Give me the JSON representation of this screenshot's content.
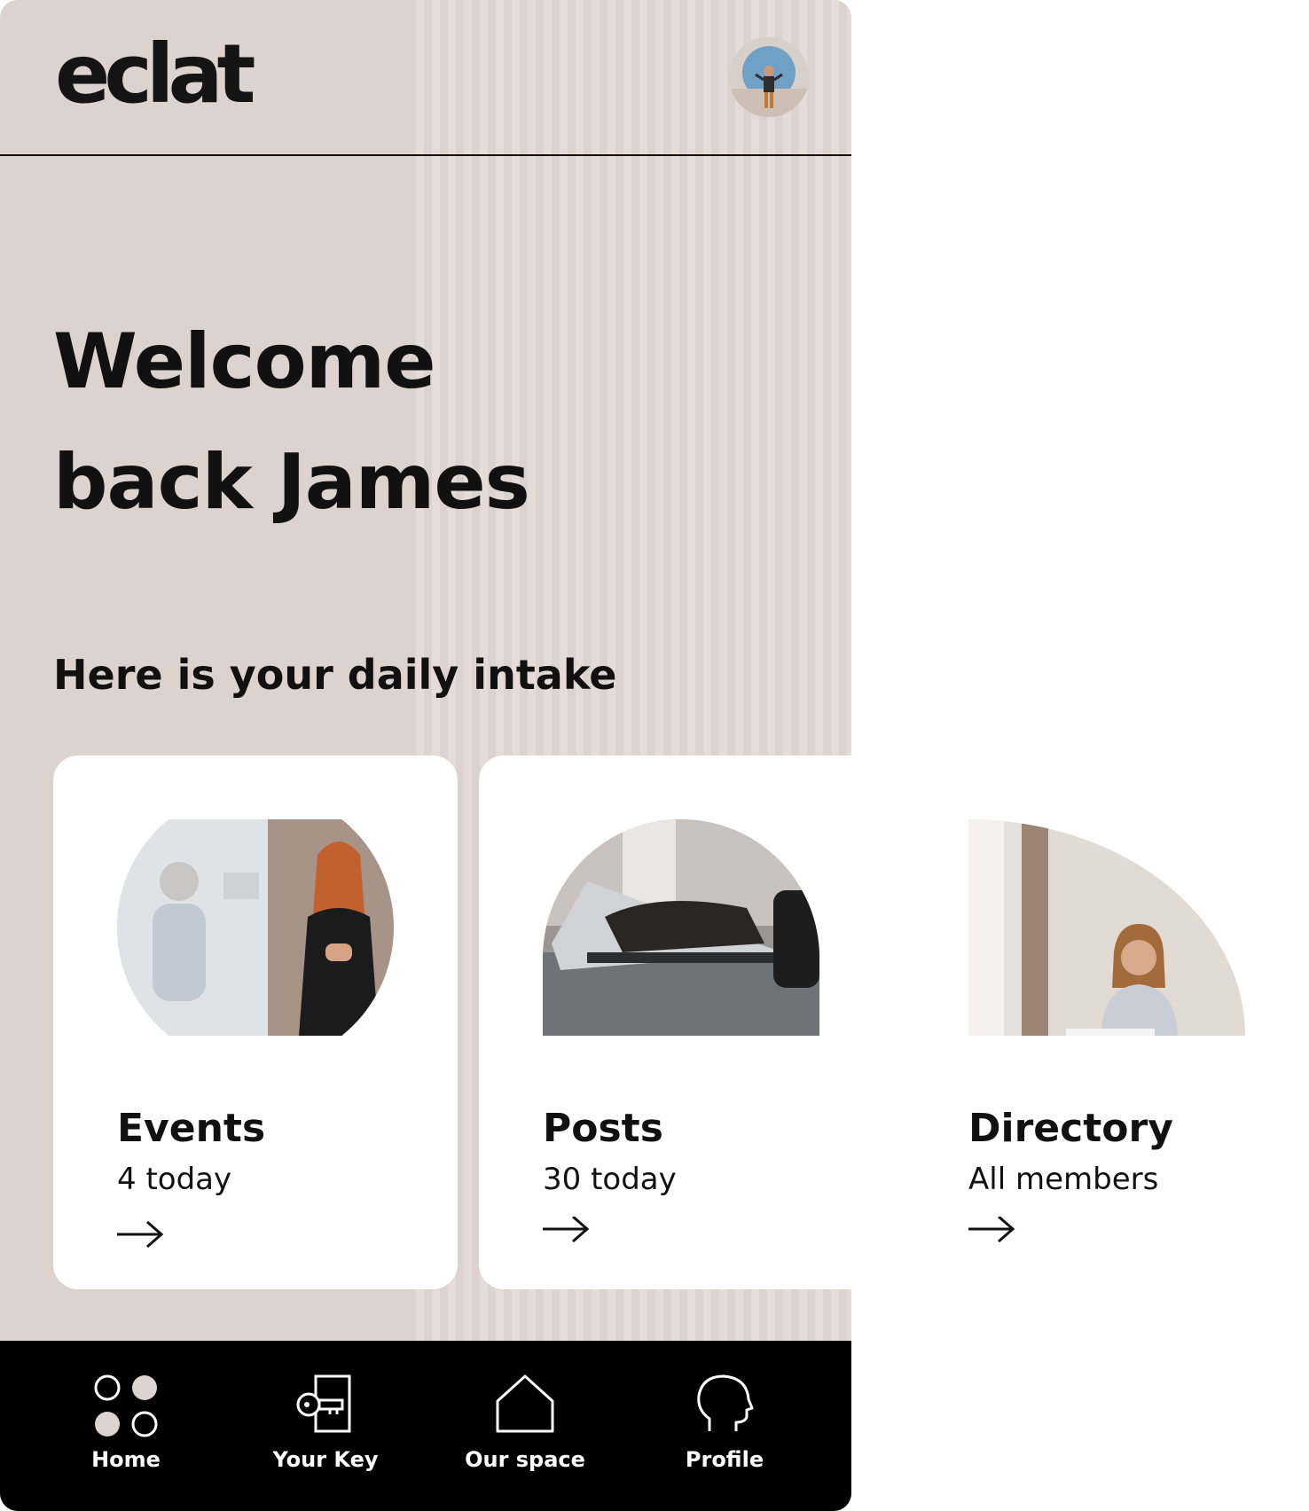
{
  "header": {
    "logo_text": "eclat"
  },
  "hero": {
    "line1": "Welcome",
    "line2": "back James"
  },
  "section": {
    "title": "Here is your daily intake"
  },
  "cards": [
    {
      "title": "Events",
      "subtitle": "4 today"
    },
    {
      "title": "Posts",
      "subtitle": "30 today"
    },
    {
      "title": "Directory",
      "subtitle": "All members"
    }
  ],
  "nav": [
    {
      "label": "Home",
      "icon": "home-dots-icon"
    },
    {
      "label": "Your Key",
      "icon": "key-door-icon"
    },
    {
      "label": "Our space",
      "icon": "house-icon"
    },
    {
      "label": "Profile",
      "icon": "head-profile-icon"
    }
  ],
  "colors": {
    "background": "#dcd3cf",
    "stripe": "#e5dbd8",
    "nav": "#000000",
    "card": "#ffffff"
  }
}
